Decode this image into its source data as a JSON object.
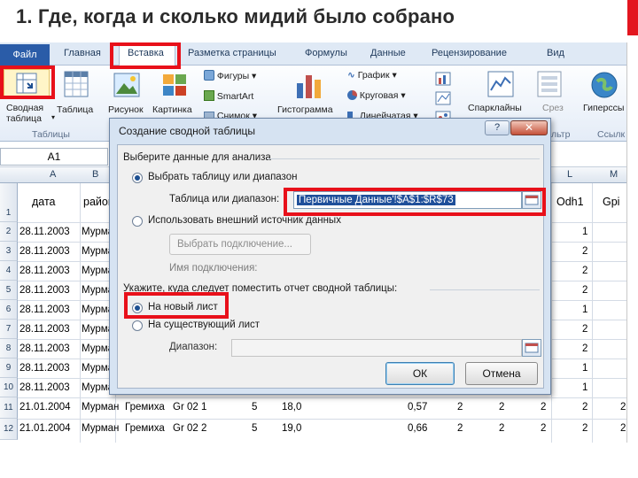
{
  "slide": {
    "title": "1. Где, когда и сколько мидий было собрано"
  },
  "ribbon": {
    "tabs": [
      "Файл",
      "Главная",
      "Вставка",
      "Разметка страницы",
      "Формулы",
      "Данные",
      "Рецензирование",
      "Вид"
    ],
    "buttons": {
      "pivot": "Сводная\nтаблица",
      "table": "Таблица",
      "picture": "Рисунок",
      "clipart": "Картинка",
      "shapes": "Фигуры",
      "smartart": "SmartArt",
      "snapshot": "Снимок",
      "histogram": "Гистограмма",
      "graph": "График",
      "pie": "Круговая",
      "bar": "Линейчатая",
      "sparklines": "Спарклайны",
      "slicer": "Срез",
      "hyperlink": "Гиперссы"
    },
    "groups": {
      "tables": "Таблицы",
      "filter": "льтр",
      "links": "Ссылк"
    }
  },
  "formula_bar": {
    "name_box": "A1"
  },
  "sheet": {
    "columns": [
      "A",
      "B",
      "L",
      "M"
    ],
    "headers": {
      "A": "дата",
      "B": "район",
      "L": "Odh1",
      "M": "Gpi"
    },
    "rows": [
      {
        "n": "2",
        "date": "28.11.2003",
        "region": "Мурма",
        "l": "1",
        "m": ""
      },
      {
        "n": "3",
        "date": "28.11.2003",
        "region": "Мурма",
        "l": "2",
        "m": ""
      },
      {
        "n": "4",
        "date": "28.11.2003",
        "region": "Мурма",
        "l": "2",
        "m": ""
      },
      {
        "n": "5",
        "date": "28.11.2003",
        "region": "Мурма",
        "l": "2",
        "m": ""
      },
      {
        "n": "6",
        "date": "28.11.2003",
        "region": "Мурма",
        "l": "1",
        "m": ""
      },
      {
        "n": "7",
        "date": "28.11.2003",
        "region": "Мурма",
        "l": "2",
        "m": ""
      },
      {
        "n": "8",
        "date": "28.11.2003",
        "region": "Мурма",
        "l": "2",
        "m": ""
      },
      {
        "n": "9",
        "date": "28.11.2003",
        "region": "Мурма",
        "l": "1",
        "m": ""
      },
      {
        "n": "10",
        "date": "28.11.2003",
        "region": "Мурма",
        "l": "1",
        "m": ""
      }
    ],
    "bottom_rows": [
      {
        "n": "11",
        "cells": [
          "21.01.2004",
          "Мурман",
          "Гремиха",
          "Gr 02 1",
          "5",
          "18,0",
          "0,57",
          "2",
          "2",
          "2",
          "2",
          "2"
        ]
      },
      {
        "n": "12",
        "cells": [
          "21.01.2004",
          "Мурман",
          "Гремиха",
          "Gr 02 2",
          "5",
          "19,0",
          "0,66",
          "2",
          "2",
          "2",
          "2",
          "2"
        ]
      }
    ]
  },
  "dialog": {
    "title": "Создание сводной таблицы",
    "help": "?",
    "close": "✕",
    "section1": "Выберите данные для анализа",
    "opt_range": "Выбрать таблицу или диапазон",
    "range_label": "Таблица или диапазон:",
    "range_value": "Первичные Данные'!$A$1:$R$73",
    "opt_external": "Использовать внешний источник данных",
    "choose_conn": "Выбрать подключение...",
    "conn_name": "Имя подключения:",
    "section2": "Укажите, куда следует поместить отчет сводной таблицы:",
    "opt_new": "На новый лист",
    "opt_existing": "На существующий лист",
    "location_label": "Диапазон:",
    "ok": "ОК",
    "cancel": "Отмена"
  },
  "colors": {
    "highlight": "#e8101a",
    "file_tab": "#2a5ca8",
    "ribbon": "#dfe9f5"
  }
}
